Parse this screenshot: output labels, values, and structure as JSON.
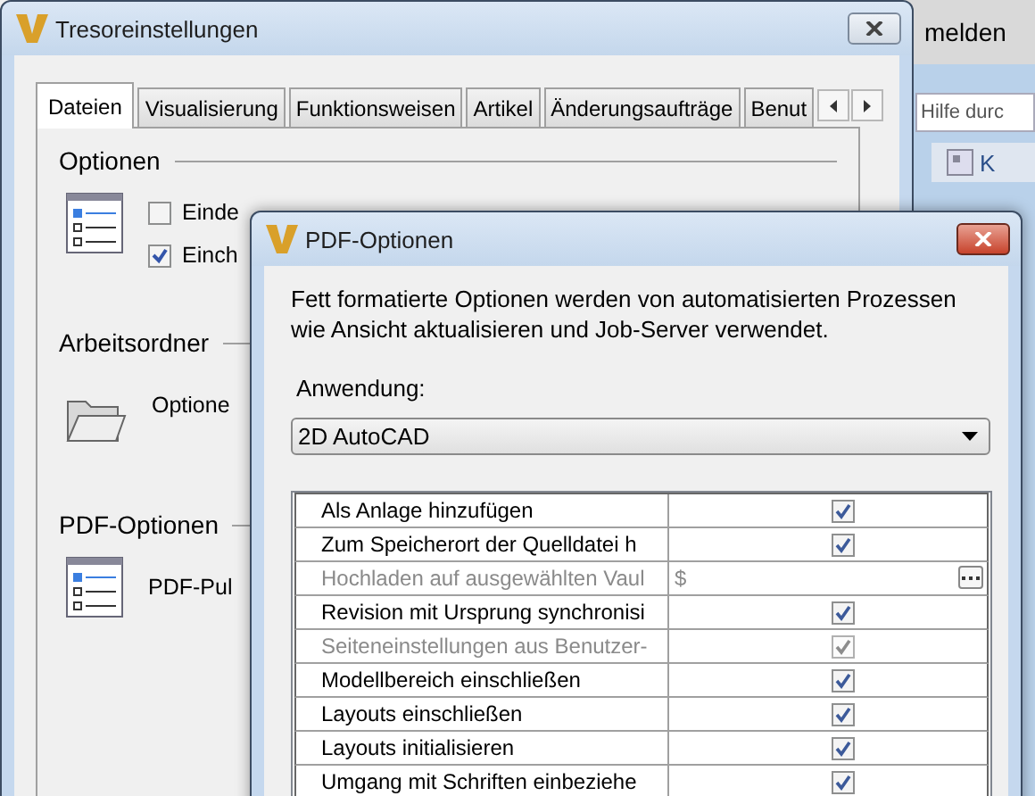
{
  "background_app": {
    "menu_item": "melden",
    "search": {
      "placeholder": "Hilfe durc"
    },
    "toolbar_text": "K"
  },
  "settings_window": {
    "title": "Tresoreinstellungen",
    "tabs": [
      {
        "label": "Dateien",
        "selected": true
      },
      {
        "label": "Visualisierung",
        "selected": false
      },
      {
        "label": "Funktionsweisen",
        "selected": false
      },
      {
        "label": "Artikel",
        "selected": false
      },
      {
        "label": "Änderungsaufträge",
        "selected": false
      },
      {
        "label": "Benut",
        "selected": false
      }
    ],
    "sections": [
      {
        "kind": "list",
        "heading": "Optionen",
        "checkboxes": [
          {
            "label": "Einde",
            "checked": false
          },
          {
            "label": "Einch",
            "checked": true
          }
        ]
      },
      {
        "kind": "folder",
        "heading": "Arbeitsordner",
        "text": "Optione"
      },
      {
        "kind": "list",
        "heading": "PDF-Optionen",
        "text": "PDF-Pul"
      }
    ]
  },
  "pdf_dialog": {
    "title": "PDF-Optionen",
    "description": "Fett formatierte Optionen werden von automatisierten Prozessen wie Ansicht aktualisieren und Job-Server verwendet.",
    "application_label": "Anwendung:",
    "application": "2D AutoCAD",
    "rows": [
      {
        "kind": "checkbox",
        "label": "Als Anlage hinzufügen",
        "checked": true,
        "disabled": false
      },
      {
        "kind": "checkbox",
        "label": "Zum Speicherort der Quelldatei h",
        "checked": true,
        "disabled": false
      },
      {
        "kind": "path",
        "label": "Hochladen auf ausgewählten Vaul",
        "value": "$",
        "disabled": true
      },
      {
        "kind": "checkbox",
        "label": "Revision mit Ursprung synchronisi",
        "checked": true,
        "disabled": false
      },
      {
        "kind": "checkbox",
        "label": "Seiteneinstellungen aus Benutzer-",
        "checked": true,
        "disabled": true
      },
      {
        "kind": "checkbox",
        "label": "Modellbereich einschließen",
        "checked": true,
        "disabled": false
      },
      {
        "kind": "checkbox",
        "label": "Layouts einschließen",
        "checked": true,
        "disabled": false
      },
      {
        "kind": "checkbox",
        "label": "Layouts initialisieren",
        "checked": true,
        "disabled": false
      },
      {
        "kind": "checkbox",
        "label": "Umgang mit Schriften einbeziehe",
        "checked": true,
        "disabled": false
      }
    ]
  }
}
